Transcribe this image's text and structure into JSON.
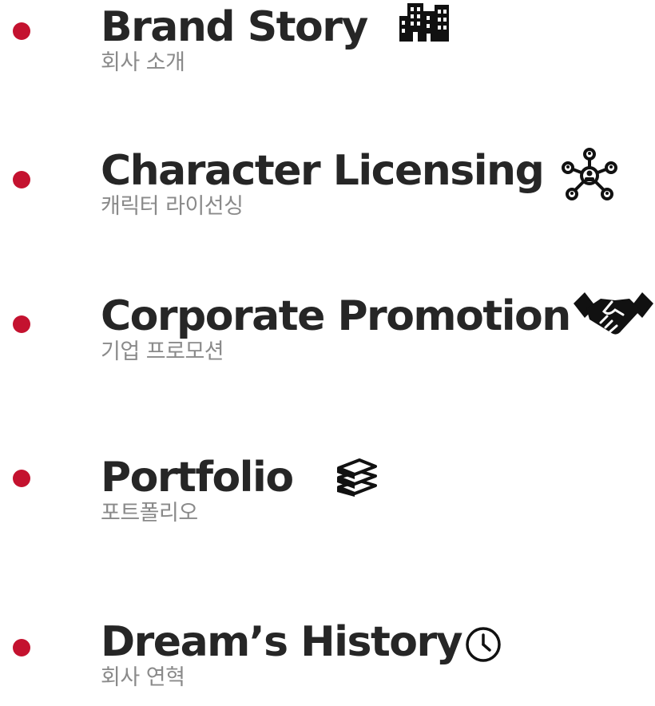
{
  "colors": {
    "accent": "#c4122f",
    "title": "#262626",
    "subtitle": "#8a8a8a"
  },
  "menu": [
    {
      "title": "Brand Story",
      "subtitle": "회사 소개",
      "icon": "building-icon"
    },
    {
      "title": "Character Licensing",
      "subtitle": "캐릭터 라이선싱",
      "icon": "network-icon"
    },
    {
      "title": "Corporate Promotion",
      "subtitle": "기업 프로모션",
      "icon": "handshake-icon"
    },
    {
      "title": "Portfolio",
      "subtitle": "포트폴리오",
      "icon": "books-icon"
    },
    {
      "title": "Dream’s History",
      "subtitle": "회사 연혁",
      "icon": "clock-icon"
    }
  ]
}
